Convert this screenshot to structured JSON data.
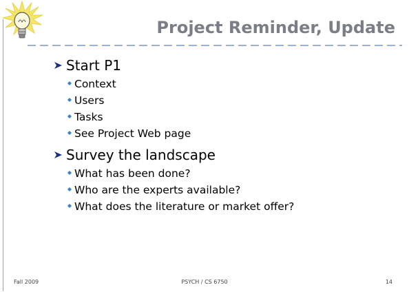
{
  "slide": {
    "title": "Project Reminder, Update",
    "bullets": [
      {
        "text": "Start P1",
        "sub": [
          "Context",
          "Users",
          "Tasks",
          "See Project Web page"
        ]
      },
      {
        "text": "Survey the landscape",
        "sub": [
          "What has been done?",
          "Who are the experts available?",
          "What does the literature or market offer?"
        ]
      }
    ],
    "footer": {
      "left": "Fall 2009",
      "center": "PSYCH / CS 6750",
      "right": "14"
    }
  },
  "colors": {
    "title": "#7a7e86",
    "rule": "#9ab0d8",
    "arrow": "#1a2f8a",
    "diamond": "#3b7fc4",
    "bulb_glow": "#f5e66a"
  },
  "icons": {
    "logo": "lightbulb-icon",
    "level1_marker": "arrow-bullet-icon",
    "level2_marker": "diamond-bullet-icon"
  }
}
